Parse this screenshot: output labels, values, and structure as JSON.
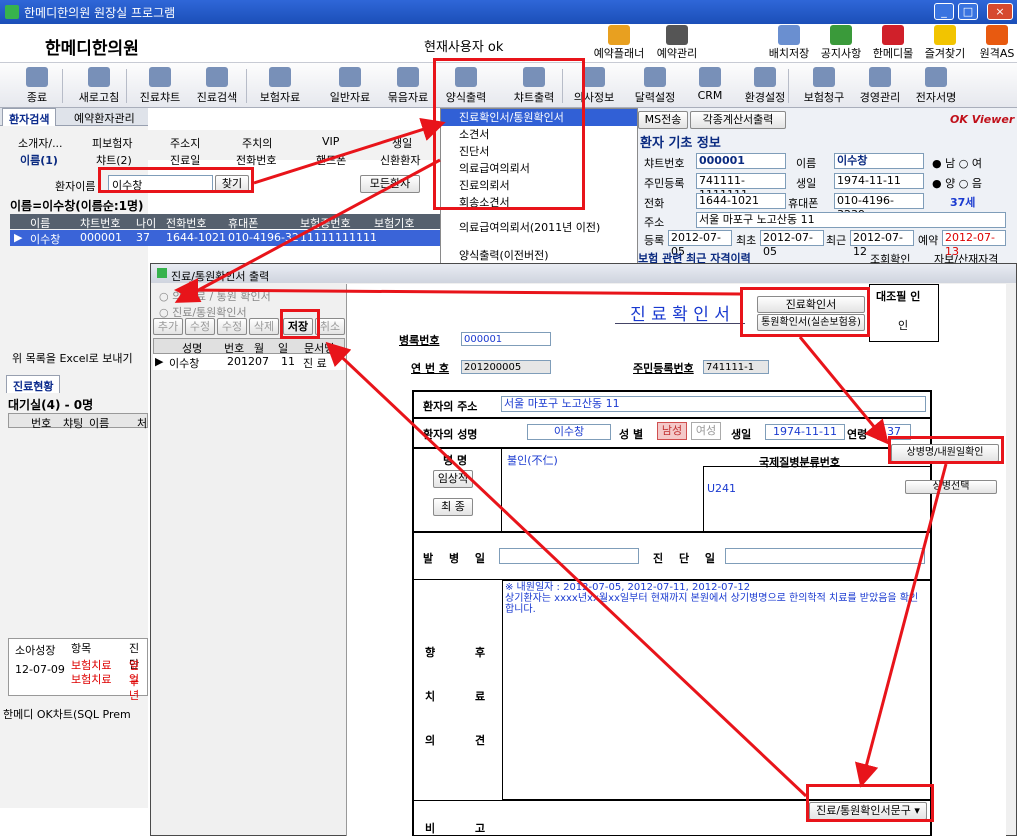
{
  "window": {
    "title": "한메디한의원 원장실 프로그램",
    "min": "_",
    "max": "□",
    "close": "×"
  },
  "header": {
    "clinic_name": "한메디한의원",
    "current_user_label": "현재사용자 ok",
    "buttons": [
      {
        "label": "예약플래너",
        "icon": "calendar-icon",
        "color": "#e8a020"
      },
      {
        "label": "예약관리",
        "icon": "calendar-grid-icon",
        "color": "#555555"
      },
      {
        "label": "배치저장",
        "icon": "layout-icon",
        "color": "#6a8fd0"
      },
      {
        "label": "공지사항",
        "icon": "notice-icon",
        "color": "#3a9a3a"
      },
      {
        "label": "한메디몰",
        "icon": "mall-icon",
        "color": "#d0202a"
      },
      {
        "label": "즐겨찾기",
        "icon": "star-icon",
        "color": "#f2c400"
      },
      {
        "label": "원격AS",
        "icon": "remote-icon",
        "color": "#e85a10"
      }
    ]
  },
  "toolbar": [
    {
      "label": "종료",
      "icon": "exit-icon"
    },
    {
      "label": "새로고침",
      "icon": "refresh-icon"
    },
    {
      "label": "진료챠트",
      "icon": "chart-icon"
    },
    {
      "label": "진료검색",
      "icon": "search-icon"
    },
    {
      "label": "보험자료",
      "icon": "folder-icon"
    },
    {
      "label": "일반자료",
      "icon": "folder-icon"
    },
    {
      "label": "묶음자료",
      "icon": "folder-icon"
    },
    {
      "label": "양식출력",
      "icon": "printer-icon"
    },
    {
      "label": "챠트출력",
      "icon": "chart-print-icon"
    },
    {
      "label": "의사정보",
      "icon": "doctor-icon"
    },
    {
      "label": "달력설정",
      "icon": "calendar-icon"
    },
    {
      "label": "CRM",
      "icon": "crm-icon"
    },
    {
      "label": "환경설정",
      "icon": "settings-icon"
    },
    {
      "label": "보험청구",
      "icon": "claim-icon"
    },
    {
      "label": "경영관리",
      "icon": "manage-icon"
    },
    {
      "label": "전자서명",
      "icon": "sign-icon"
    }
  ],
  "left": {
    "tabs": [
      "환자검색",
      "예약환자관리"
    ],
    "subtabs1": [
      "소개자/...",
      "피보험자",
      "주소지",
      "주치의",
      "VIP",
      "생일"
    ],
    "subtabs2": [
      "이름(1)",
      "챠트(2)",
      "진료일",
      "전화번호",
      "핸드폰",
      "신환환자"
    ],
    "search_label": "환자이름",
    "search_value": "이수창",
    "find_button": "찾기",
    "all_button": "모든환자",
    "result_label": "이름=이수창(이름순:1명)",
    "columns": [
      "이름",
      "챠트번호",
      "나이",
      "전화번호",
      "휴대폰",
      "보험증번호",
      "보험기호"
    ],
    "row": [
      "이수창",
      "000001",
      "37",
      "1644-1021",
      "010-4196-32",
      "11111111111",
      ""
    ],
    "excel_label": "위 목록을 Excel로 보내기",
    "status_tab": "진료현황",
    "waiting": "대기실(4) - 0명",
    "wait_columns": [
      "번호",
      "챠팅",
      "이름",
      "처"
    ],
    "bottom_cols": [
      "소아성장",
      "항목",
      "진단"
    ],
    "bottom_date": "12-07-09",
    "bottom_items": [
      "보험치료",
      "보험치료"
    ],
    "bottom_diag": [
      "옆구",
      "일년"
    ],
    "status_bar": "한메디 OK차트(SQL Prem"
  },
  "dropdown": {
    "items": [
      "진료확인서/통원확인서",
      "소견서",
      "진단서",
      "의료급여의뢰서",
      "진료의뢰서",
      "회송소견서"
    ],
    "item_extra1": "의료급여의뢰서(2011년 이전)",
    "item_extra2": "양식출력(이전버전)"
  },
  "info": {
    "sms": "MS전송",
    "tax": "각종계산서출력",
    "viewer": "OK Viewer",
    "section_title": "환자 기초 정보",
    "chart_no_label": "챠트번호",
    "chart_no": "000001",
    "name_label": "이름",
    "name": "이수창",
    "gender_m": "남",
    "gender_f": "여",
    "rrn_label": "주민등록",
    "rrn": "741111-1111111",
    "birth_label": "생일",
    "birth": "1974-11-11",
    "solar": "양",
    "lunar": "음",
    "phone_label": "전화",
    "phone": "1644-1021",
    "mobile_label": "휴대폰",
    "mobile": "010-4196-3239",
    "age": "37세",
    "addr_label": "주소",
    "addr": "서울 마포구 노고산동 11",
    "reg_label": "등록",
    "reg": "2012-07-05",
    "first_label": "최초",
    "first": "2012-07-05",
    "last_label": "최근",
    "last": "2012-07-12",
    "reserve_label": "예약",
    "reserve": "2012-07-13",
    "ins_title": "보험 관련 최근 자격이력",
    "ins_check": "조회확인",
    "ins_more": "자보/산재자격"
  },
  "dialog": {
    "title": "진료/통원확인서 출력",
    "hint1": "의 진료 / 통원 확인서",
    "hint2": "진료/통원확인서",
    "btns": [
      "추가",
      "수정",
      "수정",
      "삭제",
      "저장",
      "취소"
    ],
    "list_cols": [
      "성명",
      "번호",
      "월",
      "일",
      "문서명"
    ],
    "list_row": [
      "이수창",
      "2012",
      "07",
      "11",
      "진 료"
    ],
    "doc_title": "진 료 확 인 서",
    "type_btn1": "진료확인서",
    "type_btn2": "통원확인서(실손보험용)",
    "seal_label": "대조필 인",
    "seal_val": "인",
    "record_label": "병록번호",
    "record_no": "000001",
    "serial_label": "연 번 호",
    "serial_no": "201200005",
    "rrn_label": "주민등록번호",
    "rrn": "741111-1",
    "addr_label": "환자의 주소",
    "addr": "서울 마포구 노고산동 11",
    "name_label": "환자의 성명",
    "name": "이수창",
    "sex_label": "성 별",
    "male": "남성",
    "female": "여성",
    "birth_label": "생일",
    "birth": "1974-11-11",
    "age_label": "연령",
    "age": "37",
    "disease_label": "병 명",
    "disease": "불인(不仁)",
    "icd_label": "국제질병분류번호",
    "icd": "U241",
    "diag_btn": "상병명/내원일확인",
    "diag_btn2": "상병선택",
    "clinical": "임상적",
    "final": "최 종",
    "onset_label": "발 병 일",
    "diagdate_label": "진 단 일",
    "visit_line": "※ 내원일자 : 2012-07-05, 2012-07-11, 2012-07-12",
    "opinion_text": "상기환자는 xxxx년xx월xx일부터 현재까지 본원에서 상기병명으로 한의학적 치료를 받았음을 확인합니다.",
    "future_label": [
      "향",
      "후",
      "치",
      "료",
      "의",
      "견"
    ],
    "future_label2": [
      "비",
      "고"
    ],
    "bottom_btn": "진료/통원확인서문구"
  }
}
